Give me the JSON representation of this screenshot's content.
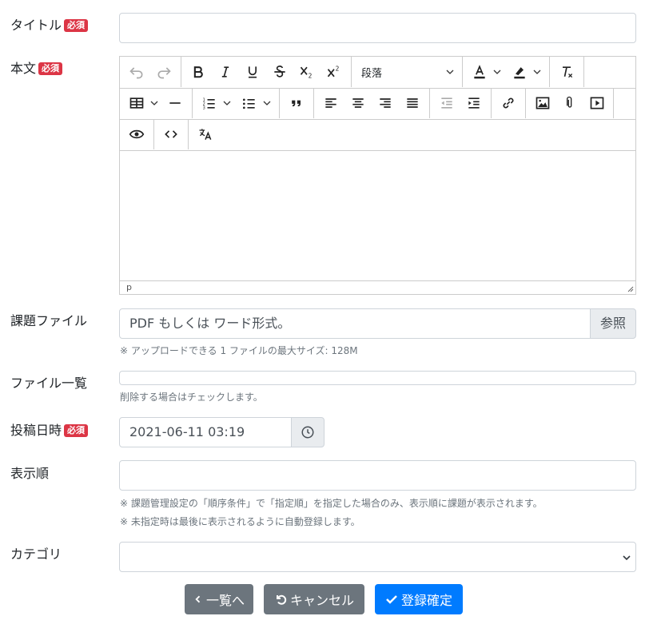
{
  "fields": {
    "title": {
      "label": "タイトル",
      "required_badge": "必須",
      "value": ""
    },
    "body": {
      "label": "本文",
      "required_badge": "必須"
    },
    "task_file": {
      "label": "課題ファイル",
      "placeholder": "PDF もしくは ワード形式。",
      "browse_label": "参照",
      "help": "※ アップロードできる 1 ファイルの最大サイズ: 128M"
    },
    "file_list": {
      "label": "ファイル一覧",
      "help": "削除する場合はチェックします。"
    },
    "post_datetime": {
      "label": "投稿日時",
      "required_badge": "必須",
      "value": "2021-06-11 03:19"
    },
    "display_order": {
      "label": "表示順",
      "value": "",
      "help1": "※ 課題管理設定の「順序条件」で「指定順」を指定した場合のみ、表示順に課題が表示されます。",
      "help2": "※ 未指定時は最後に表示されるように自動登録します。"
    },
    "category": {
      "label": "カテゴリ",
      "value": ""
    }
  },
  "editor": {
    "block_format": "段落",
    "status_path": "p",
    "content": ""
  },
  "buttons": {
    "back": "一覧へ",
    "cancel": "キャンセル",
    "submit": "登録確定"
  },
  "colors": {
    "required": "#dc3545",
    "primary": "#007bff",
    "secondary": "#6c757d"
  }
}
